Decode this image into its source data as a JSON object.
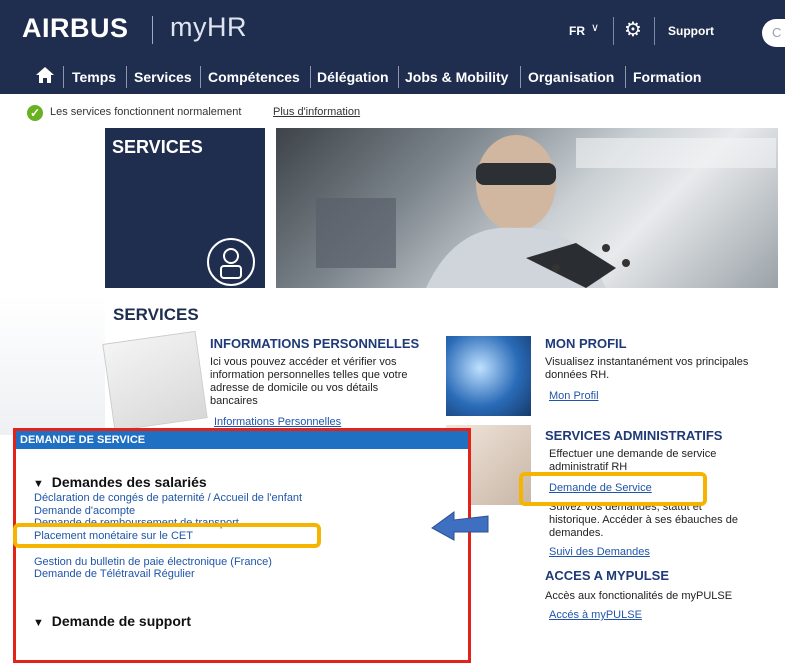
{
  "header": {
    "logo": "AIRBUS",
    "app_name": "myHR",
    "language": "FR",
    "language_chevron": "∨",
    "support_label": "Support",
    "search_placeholder": "C"
  },
  "nav": {
    "items": [
      "Temps",
      "Services",
      "Compétences",
      "Délégation",
      "Jobs & Mobility",
      "Organisation",
      "Formation"
    ]
  },
  "status": {
    "text": "Les services fonctionnent normalement",
    "link": "Plus d'information",
    "color": "#6ab023"
  },
  "hero": {
    "title": "SERVICES"
  },
  "services": {
    "title": "SERVICES",
    "info_perso": {
      "title": "INFORMATIONS PERSONNELLES",
      "desc": [
        "Ici vous pouvez accéder et vérifier vos",
        "information personnelles telles que votre",
        "adresse de domicile ou vos détails",
        "bancaires"
      ],
      "link": "Informations Personnelles"
    },
    "mon_profil": {
      "title": "MON PROFIL",
      "desc": [
        "Visualisez instantanément vos principales",
        "données RH."
      ],
      "link": "Mon Profil"
    },
    "services_admin": {
      "title": "SERVICES ADMINISTRATIFS",
      "desc1": [
        "Effectuer une demande de service",
        "administratif RH"
      ],
      "link1": "Demande de Service",
      "desc2": [
        "Suivez vos demandes, statut et",
        "historique. Accéder à ses ébauches de",
        "demandes."
      ],
      "link2": "Suivi des Demandes"
    },
    "mypulse": {
      "title": "ACCES A MYPULSE",
      "desc": "Accès aux fonctionalités de myPULSE",
      "link": "Accés à myPULSE"
    }
  },
  "demande_service": {
    "header": "DEMANDE DE SERVICE",
    "group1": "Demandes des salariés",
    "links": [
      "Déclaration de congés de paternité / Accueil de l'enfant",
      "Demande d'acompte",
      "Demande de remboursement de transport",
      "Placement monétaire sur le CET",
      "Gestion du bulletin de paie électronique (France)",
      "Demande de Télétravail Régulier"
    ],
    "group2": "Demande de support"
  },
  "colors": {
    "navy": "#1f2d4f",
    "link_blue": "#1f55a8",
    "highlight": "#f5b400",
    "box_border": "#e2231a",
    "box_header": "#1f6fc3"
  }
}
